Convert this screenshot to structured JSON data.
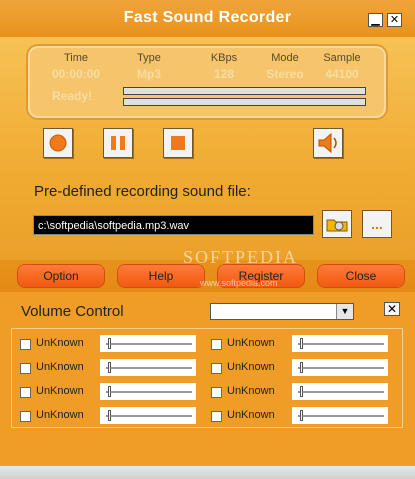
{
  "window": {
    "title": "Fast Sound Recorder",
    "minimize_glyph": "▁",
    "close_glyph": "✕"
  },
  "info": {
    "headers": [
      "Time",
      "Type",
      "KBps",
      "Mode",
      "Sample"
    ],
    "values": [
      "00:00:00",
      "Mp3",
      "128",
      "Stereo",
      "44100"
    ],
    "status": "Ready!"
  },
  "controls": {
    "icons": [
      "record-icon",
      "pause-icon",
      "stop-icon",
      "speaker-icon"
    ]
  },
  "file": {
    "label": "Pre-defined recording sound file:",
    "path": "c:\\softpedia\\softpedia.mp3.wav",
    "browse_icon": "folder-disk-icon",
    "more_label": "..."
  },
  "buttons": {
    "option": "Option",
    "help": "Help",
    "register": "Register",
    "close": "Close"
  },
  "watermark": {
    "text": "SOFTPEDIA",
    "url": "www.softpedia.com"
  },
  "volume": {
    "label": "Volume Control",
    "close_glyph": "✕",
    "channels": [
      {
        "label": "UnKnown"
      },
      {
        "label": "UnKnown"
      },
      {
        "label": "UnKnown"
      },
      {
        "label": "UnKnown"
      },
      {
        "label": "UnKnown"
      },
      {
        "label": "UnKnown"
      },
      {
        "label": "UnKnown"
      },
      {
        "label": "UnKnown"
      }
    ]
  },
  "colors": {
    "accent": "#f05a10",
    "panel": "#ef9d27",
    "record_dot": "#f07a1a"
  }
}
